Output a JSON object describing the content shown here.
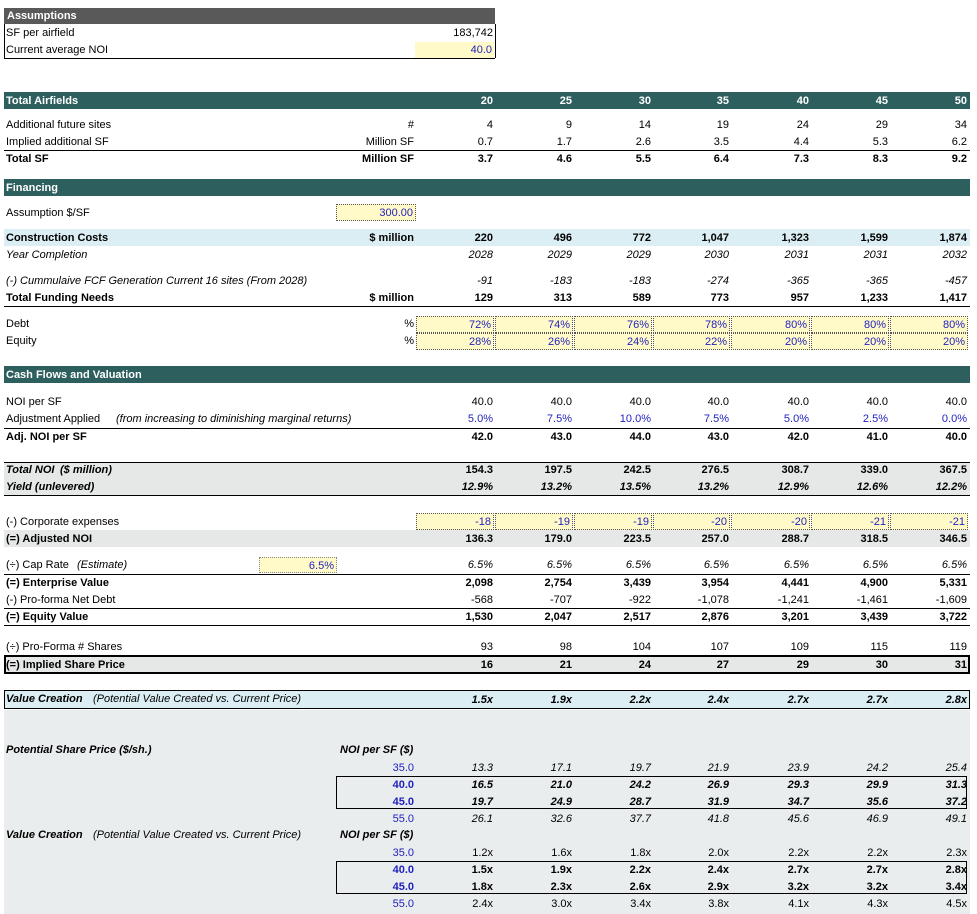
{
  "assumptions": {
    "title": "Assumptions",
    "sf_label": "SF per airfield",
    "sf_value": "183,742",
    "noi_label": "Current average NOI",
    "noi_value": "40.0"
  },
  "columns": [
    "20",
    "25",
    "30",
    "35",
    "40",
    "45",
    "50"
  ],
  "total_airfields_label": "Total Airfields",
  "rows_sites": [
    {
      "label": "Additional future sites",
      "unit": "#",
      "values": [
        "4",
        "9",
        "14",
        "19",
        "24",
        "29",
        "34"
      ]
    },
    {
      "label": "Implied additional SF",
      "unit": "Million SF",
      "values": [
        "0.7",
        "1.7",
        "2.6",
        "3.5",
        "4.4",
        "5.3",
        "6.2"
      ]
    },
    {
      "label": "Total SF",
      "unit": "Million SF",
      "values": [
        "3.7",
        "4.6",
        "5.5",
        "6.4",
        "7.3",
        "8.3",
        "9.2"
      ]
    }
  ],
  "financing": {
    "title": "Financing",
    "assumption_label": "Assumption $/SF",
    "assumption_value": "300.00",
    "construction_label": "Construction Costs",
    "construction_unit": "$ million",
    "construction_values": [
      "220",
      "496",
      "772",
      "1,047",
      "1,323",
      "1,599",
      "1,874"
    ],
    "year_label": "Year Completion",
    "year_values": [
      "2028",
      "2029",
      "2029",
      "2030",
      "2031",
      "2031",
      "2032"
    ],
    "fcf_label": "(-) Cummulaive FCF Generation Current 16 sites (From 2028)",
    "fcf_values": [
      "-91",
      "-183",
      "-183",
      "-274",
      "-365",
      "-365",
      "-457"
    ],
    "funding_label": "Total Funding Needs",
    "funding_unit": "$ million",
    "funding_values": [
      "129",
      "313",
      "589",
      "773",
      "957",
      "1,233",
      "1,417"
    ],
    "debt_label": "Debt",
    "debt_unit": "%",
    "debt_values": [
      "72%",
      "74%",
      "76%",
      "78%",
      "80%",
      "80%",
      "80%"
    ],
    "equity_label": "Equity",
    "equity_unit": "%",
    "equity_values": [
      "28%",
      "26%",
      "24%",
      "22%",
      "20%",
      "20%",
      "20%"
    ]
  },
  "cashflows": {
    "title": "Cash Flows and Valuation",
    "noi_label": "NOI per SF",
    "noi_values": [
      "40.0",
      "40.0",
      "40.0",
      "40.0",
      "40.0",
      "40.0",
      "40.0"
    ],
    "adj_label": "Adjustment Applied",
    "adj_note": "(from increasing to diminishing marginal returns)",
    "adj_values": [
      "5.0%",
      "7.5%",
      "10.0%",
      "7.5%",
      "5.0%",
      "2.5%",
      "0.0%"
    ],
    "adjnoi_label": "Adj. NOI per SF",
    "adjnoi_values": [
      "42.0",
      "43.0",
      "44.0",
      "43.0",
      "42.0",
      "41.0",
      "40.0"
    ],
    "totalnoi_label": "Total NOI",
    "totalnoi_unit": "($ million)",
    "totalnoi_values": [
      "154.3",
      "197.5",
      "242.5",
      "276.5",
      "308.7",
      "339.0",
      "367.5"
    ],
    "yield_label": "Yield (unlevered)",
    "yield_values": [
      "12.9%",
      "13.2%",
      "13.5%",
      "13.2%",
      "12.9%",
      "12.6%",
      "12.2%"
    ],
    "corp_label": "(-) Corporate expenses",
    "corp_values": [
      "-18",
      "-19",
      "-19",
      "-20",
      "-20",
      "-21",
      "-21"
    ],
    "adjusted_label": "(=) Adjusted NOI",
    "adjusted_values": [
      "136.3",
      "179.0",
      "223.5",
      "257.0",
      "288.7",
      "318.5",
      "346.5"
    ],
    "cap_label": "(÷) Cap Rate",
    "cap_note": "(Estimate)",
    "cap_input": "6.5%",
    "cap_values": [
      "6.5%",
      "6.5%",
      "6.5%",
      "6.5%",
      "6.5%",
      "6.5%",
      "6.5%"
    ],
    "ev_label": "(=) Enterprise Value",
    "ev_values": [
      "2,098",
      "2,754",
      "3,439",
      "3,954",
      "4,441",
      "4,900",
      "5,331"
    ],
    "netdebt_label": "(-) Pro-forma Net Debt",
    "netdebt_values": [
      "-568",
      "-707",
      "-922",
      "-1,078",
      "-1,241",
      "-1,461",
      "-1,609"
    ],
    "equity_label": "(=) Equity Value",
    "equity_values": [
      "1,530",
      "2,047",
      "2,517",
      "2,876",
      "3,201",
      "3,439",
      "3,722"
    ],
    "shares_label": "(÷) Pro-Forma # Shares",
    "shares_values": [
      "93",
      "98",
      "104",
      "107",
      "109",
      "115",
      "119"
    ],
    "price_label": "(=) Implied Share Price",
    "price_values": [
      "16",
      "21",
      "24",
      "27",
      "29",
      "30",
      "31"
    ]
  },
  "value_creation": {
    "label": "Value Creation",
    "note": "(Potential Value Created vs. Current Price)",
    "values": [
      "1.5x",
      "1.9x",
      "2.2x",
      "2.4x",
      "2.7x",
      "2.7x",
      "2.8x"
    ]
  },
  "sensitivity_price": {
    "label": "Potential Share Price ($/sh.)",
    "axis_label": "NOI per SF ($)",
    "rows": [
      {
        "noi": "35.0",
        "values": [
          "13.3",
          "17.1",
          "19.7",
          "21.9",
          "23.9",
          "24.2",
          "25.4"
        ]
      },
      {
        "noi": "40.0",
        "values": [
          "16.5",
          "21.0",
          "24.2",
          "26.9",
          "29.3",
          "29.9",
          "31.3"
        ]
      },
      {
        "noi": "45.0",
        "values": [
          "19.7",
          "24.9",
          "28.7",
          "31.9",
          "34.7",
          "35.6",
          "37.2"
        ]
      },
      {
        "noi": "55.0",
        "values": [
          "26.1",
          "32.6",
          "37.7",
          "41.8",
          "45.6",
          "46.9",
          "49.1"
        ]
      }
    ]
  },
  "sensitivity_value": {
    "label": "Value Creation",
    "note": "(Potential Value Created vs. Current Price)",
    "axis_label": "NOI per SF ($)",
    "rows": [
      {
        "noi": "35.0",
        "values": [
          "1.2x",
          "1.6x",
          "1.8x",
          "2.0x",
          "2.2x",
          "2.2x",
          "2.3x"
        ]
      },
      {
        "noi": "40.0",
        "values": [
          "1.5x",
          "1.9x",
          "2.2x",
          "2.4x",
          "2.7x",
          "2.7x",
          "2.8x"
        ]
      },
      {
        "noi": "45.0",
        "values": [
          "1.8x",
          "2.3x",
          "2.6x",
          "2.9x",
          "3.2x",
          "3.2x",
          "3.4x"
        ]
      },
      {
        "noi": "55.0",
        "values": [
          "2.4x",
          "3.0x",
          "3.4x",
          "3.8x",
          "4.1x",
          "4.3x",
          "4.5x"
        ]
      }
    ]
  },
  "colors": {
    "header": "#2e5f5f",
    "highlight": "#fffac8",
    "light_blue": "#dbeef4",
    "gray": "#e6e8e8",
    "input_blue": "#1f1fbf"
  }
}
